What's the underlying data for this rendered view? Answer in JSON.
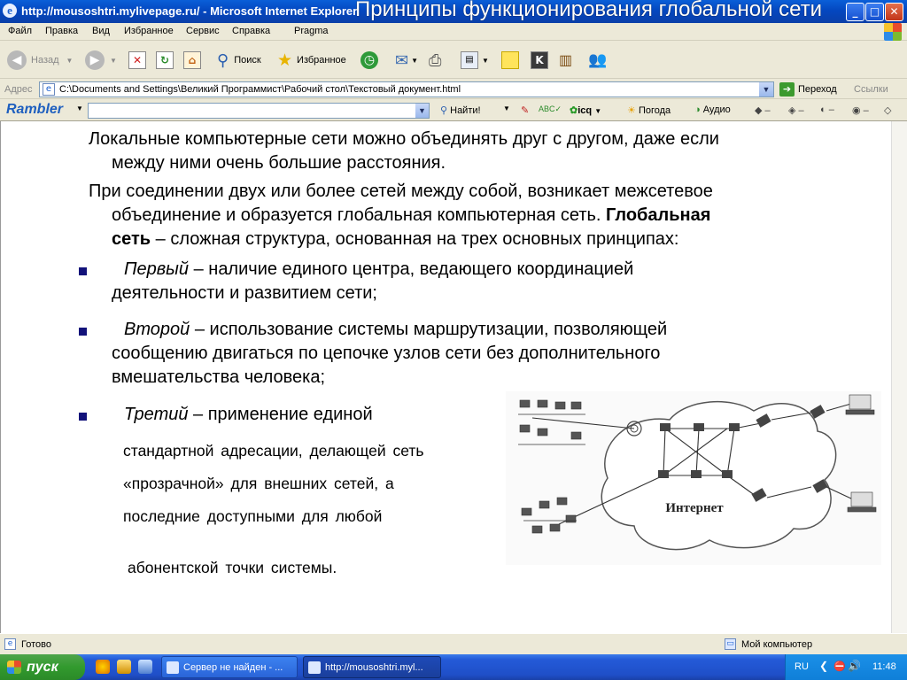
{
  "window": {
    "title": "http://mousoshtri.mylivepage.ru/ - Microsoft Internet Explorer",
    "overlay_title": "Принципы функционирования глобальной сети"
  },
  "menu": [
    "Файл",
    "Правка",
    "Вид",
    "Избранное",
    "Сервис",
    "Справка",
    "Pragma"
  ],
  "toolbar": {
    "back_label": "Назад",
    "search_label": "Поиск",
    "favorites_label": "Избранное"
  },
  "address": {
    "label": "Адрес",
    "value": "C:\\Documents and Settings\\Великий Программист\\Рабочий стол\\Текстовый документ.html",
    "go_label": "Переход",
    "links_label": "Ссылки"
  },
  "rambler": {
    "logo": "Rambler",
    "find_label": "Найти!",
    "icq_label": "icq",
    "weather_label": "Погода",
    "audio_label": "Аудио"
  },
  "content": {
    "p1_line1": "Локальные компьютерные сети можно объединять друг с другом, даже если",
    "p1_line2": "между ними очень большие расстояния.",
    "p2_line1": "При соединении двух или более сетей между собой, возникает межсетевое",
    "p2_line2": "объединение и образуется глобальная компьютерная сеть.",
    "p2_bold1": "Глобальная",
    "p2_bold2": "сеть",
    "p2_line3_rest": " – сложная структура, основанная на трех основных принципах:",
    "b1_italic": "Первый",
    "b1_line1": " – наличие единого центра, ведающего координацией",
    "b1_line2": "деятельности и развитием сети;",
    "b2_italic": "Второй",
    "b2_line1": " – использование системы маршрутизации, позволяющей",
    "b2_line2": "сообщению двигаться по цепочке узлов сети без дополнительного",
    "b2_line3": "вмешательства человека;",
    "b3_italic": "Третий",
    "b3_line1": " – применение единой",
    "b3_line2": "стандартной адресации, делающей сеть",
    "b3_line3": "«прозрачной» для внешних сетей, а",
    "b3_line4": "последние доступными для любой",
    "b3_line5": "абонентской точки системы.",
    "figure_label": "Интернет"
  },
  "status": {
    "left": "Готово",
    "right": "Мой компьютер"
  },
  "taskbar": {
    "start": "пуск",
    "task1": "Сервер не найден - ...",
    "task2": "http://mousoshtri.myl...",
    "lang": "RU",
    "clock": "11:48"
  }
}
